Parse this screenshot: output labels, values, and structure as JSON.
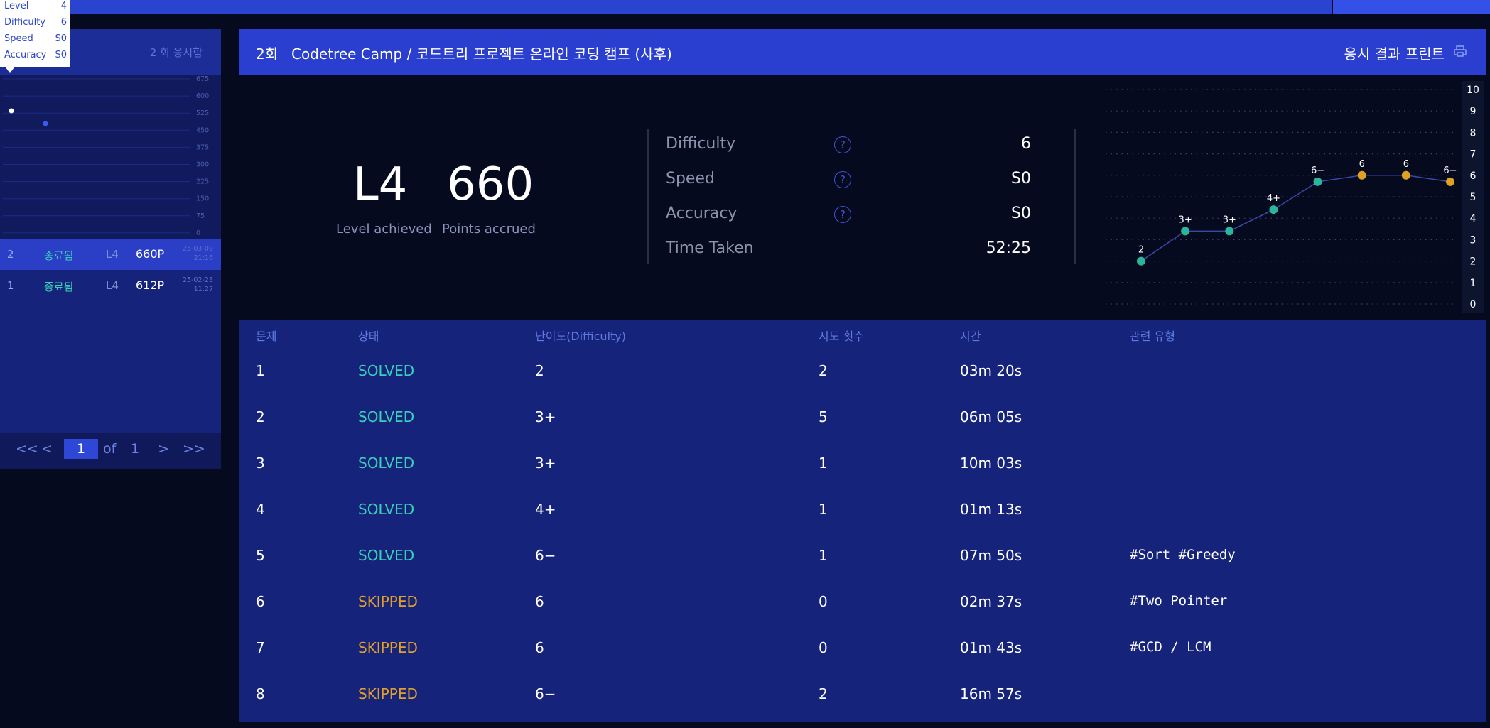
{
  "tooltip": {
    "rows": [
      {
        "label": "Level",
        "value": "4"
      },
      {
        "label": "Difficulty",
        "value": "6"
      },
      {
        "label": "Speed",
        "value": "S0"
      },
      {
        "label": "Accuracy",
        "value": "S0"
      }
    ]
  },
  "sidebar": {
    "attempt_count": "2 회 응시함",
    "chart_ticks": [
      "675",
      "600",
      "525",
      "450",
      "375",
      "300",
      "225",
      "150",
      "75",
      "0"
    ],
    "runs": [
      {
        "num": "2",
        "status": "종료됨",
        "level": "L4",
        "points": "660P",
        "date": "25-03-09",
        "time": "21:16"
      },
      {
        "num": "1",
        "status": "종료됨",
        "level": "L4",
        "points": "612P",
        "date": "25-02-23",
        "time": "11:27"
      }
    ],
    "pager": {
      "first": "<<",
      "prev": "<",
      "current": "1",
      "of": "of",
      "total": "1",
      "next": ">",
      "last": ">>"
    }
  },
  "header": {
    "round": "2회",
    "title": "Codetree Camp / 코드트리 프로젝트 온라인 코딩 캠프 (사후)",
    "print_label": "응시 결과 프린트"
  },
  "summary": {
    "level": "L4",
    "level_label": "Level achieved",
    "points": "660",
    "points_label": "Points accrued",
    "stats": [
      {
        "label": "Difficulty",
        "value": "6",
        "help": "?"
      },
      {
        "label": "Speed",
        "value": "S0",
        "help": "?"
      },
      {
        "label": "Accuracy",
        "value": "S0",
        "help": "?"
      },
      {
        "label": "Time Taken",
        "value": "52:25"
      }
    ]
  },
  "colors": {
    "solved": "#2bb59a",
    "skipped": "#e0a020",
    "accent": "#2a3fd0"
  },
  "chart_data": {
    "type": "line",
    "x": [
      1,
      2,
      3,
      4,
      5,
      6,
      7,
      8
    ],
    "values": [
      2,
      3.4,
      3.4,
      4.4,
      5.7,
      6,
      6,
      5.7
    ],
    "point_labels": [
      "2",
      "3+",
      "3+",
      "4+",
      "6−",
      "6",
      "6",
      "6−"
    ],
    "point_status": [
      "solved",
      "solved",
      "solved",
      "solved",
      "solved",
      "skipped",
      "skipped",
      "skipped"
    ],
    "yticks": [
      "10",
      "9",
      "8",
      "7",
      "6",
      "5",
      "4",
      "3",
      "2",
      "1",
      "0"
    ],
    "ylim": [
      0,
      10
    ],
    "grid": true
  },
  "table": {
    "headers": [
      "문제",
      "상태",
      "난이도(Difficulty)",
      "시도 횟수",
      "시간",
      "관련 유형"
    ],
    "rows": [
      {
        "num": "1",
        "status": "SOLVED",
        "difficulty": "2",
        "attempts": "2",
        "time": "03m 20s",
        "tags": ""
      },
      {
        "num": "2",
        "status": "SOLVED",
        "difficulty": "3+",
        "attempts": "5",
        "time": "06m 05s",
        "tags": ""
      },
      {
        "num": "3",
        "status": "SOLVED",
        "difficulty": "3+",
        "attempts": "1",
        "time": "10m 03s",
        "tags": ""
      },
      {
        "num": "4",
        "status": "SOLVED",
        "difficulty": "4+",
        "attempts": "1",
        "time": "01m 13s",
        "tags": ""
      },
      {
        "num": "5",
        "status": "SOLVED",
        "difficulty": "6−",
        "attempts": "1",
        "time": "07m 50s",
        "tags": "#Sort #Greedy"
      },
      {
        "num": "6",
        "status": "SKIPPED",
        "difficulty": "6",
        "attempts": "0",
        "time": "02m 37s",
        "tags": "#Two Pointer"
      },
      {
        "num": "7",
        "status": "SKIPPED",
        "difficulty": "6",
        "attempts": "0",
        "time": "01m 43s",
        "tags": "#GCD / LCM"
      },
      {
        "num": "8",
        "status": "SKIPPED",
        "difficulty": "6−",
        "attempts": "2",
        "time": "16m 57s",
        "tags": ""
      }
    ]
  }
}
